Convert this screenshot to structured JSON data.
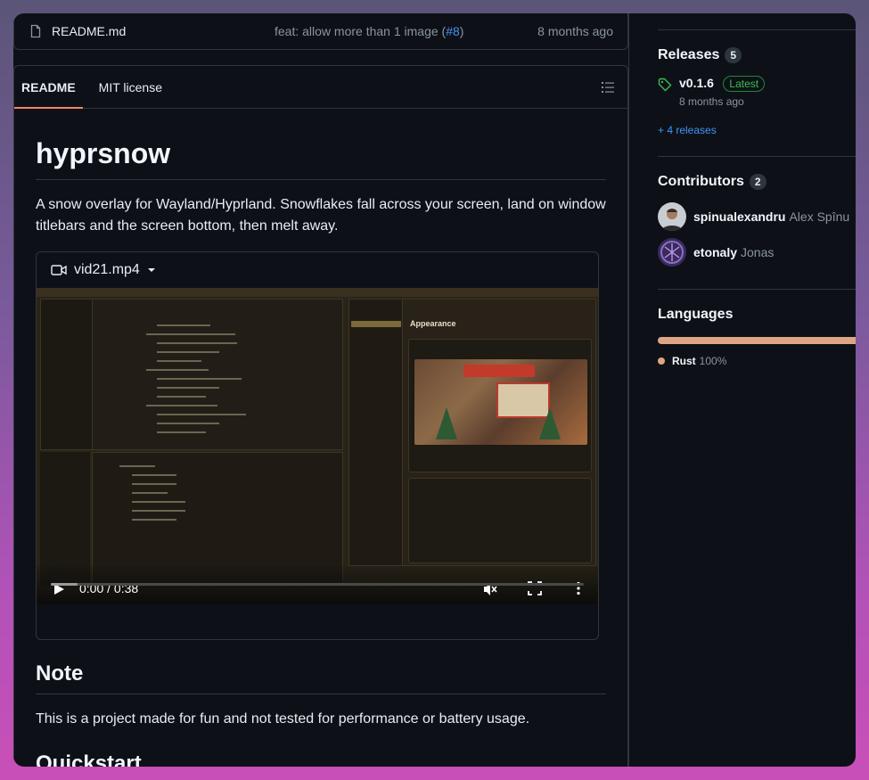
{
  "file_row": {
    "name": "README.md",
    "commit_prefix": "feat: allow more than 1 image (",
    "commit_link": "#8",
    "commit_suffix": ")",
    "time": "8 months ago"
  },
  "tabs": [
    {
      "label": "README",
      "active": true
    },
    {
      "label": "MIT license",
      "active": false
    }
  ],
  "readme": {
    "title": "hyprsnow",
    "description": "A snow overlay for Wayland/Hyprland. Snowflakes fall across your screen, land on window titlebars and the screen bottom, then melt away.",
    "video": {
      "filename": "vid21.mp4",
      "timecode": "0:00 / 0:38",
      "settings_title": "Appearance",
      "progress_fraction": 0.05
    },
    "note_heading": "Note",
    "note_text": "This is a project made for fun and not tested for performance or battery usage.",
    "next_heading": "Quickstart"
  },
  "sidebar": {
    "releases": {
      "title": "Releases",
      "count": "5",
      "latest_version": "v0.1.6",
      "latest_badge": "Latest",
      "latest_date": "8 months ago",
      "more_link": "+ 4 releases"
    },
    "contributors": {
      "title": "Contributors",
      "count": "2",
      "items": [
        {
          "username": "spinualexandru",
          "fullname": "Alex Spînu"
        },
        {
          "username": "etonaly",
          "fullname": "Jonas"
        }
      ]
    },
    "languages": {
      "title": "Languages",
      "items": [
        {
          "name": "Rust",
          "percent": "100%",
          "color": "#dea584"
        }
      ]
    }
  },
  "colors": {
    "background": "#0d1117",
    "border": "#30363d",
    "link": "#4493f8",
    "tab_underline": "#f78166",
    "latest_green": "#3fb950"
  }
}
